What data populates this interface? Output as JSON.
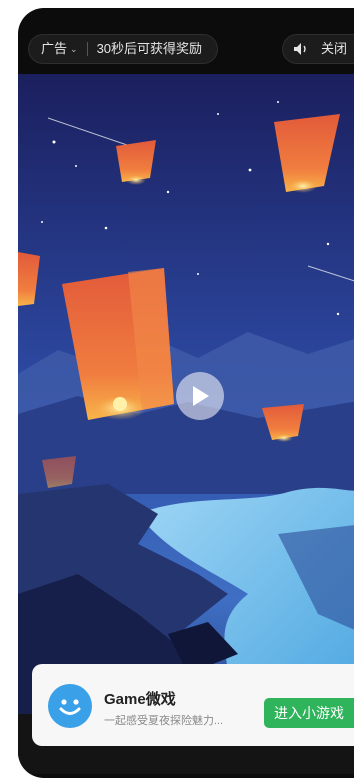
{
  "ad_bar": {
    "ad_label": "广告",
    "reward_text": "30秒后可获得奖励",
    "close_label": "关闭"
  },
  "game_card": {
    "name": "Game微戏",
    "description": "一起感受夏夜探险魅力...",
    "enter_button": "进入小游戏"
  },
  "icons": [
    "chevron-down-icon",
    "speaker-icon",
    "play-icon",
    "smiley-icon"
  ],
  "colors": {
    "button_green": "#2fb35b",
    "avatar_blue": "#3aa0e8",
    "sky_top": "#1b1f5e",
    "lantern_orange": "#ec6a3c"
  }
}
